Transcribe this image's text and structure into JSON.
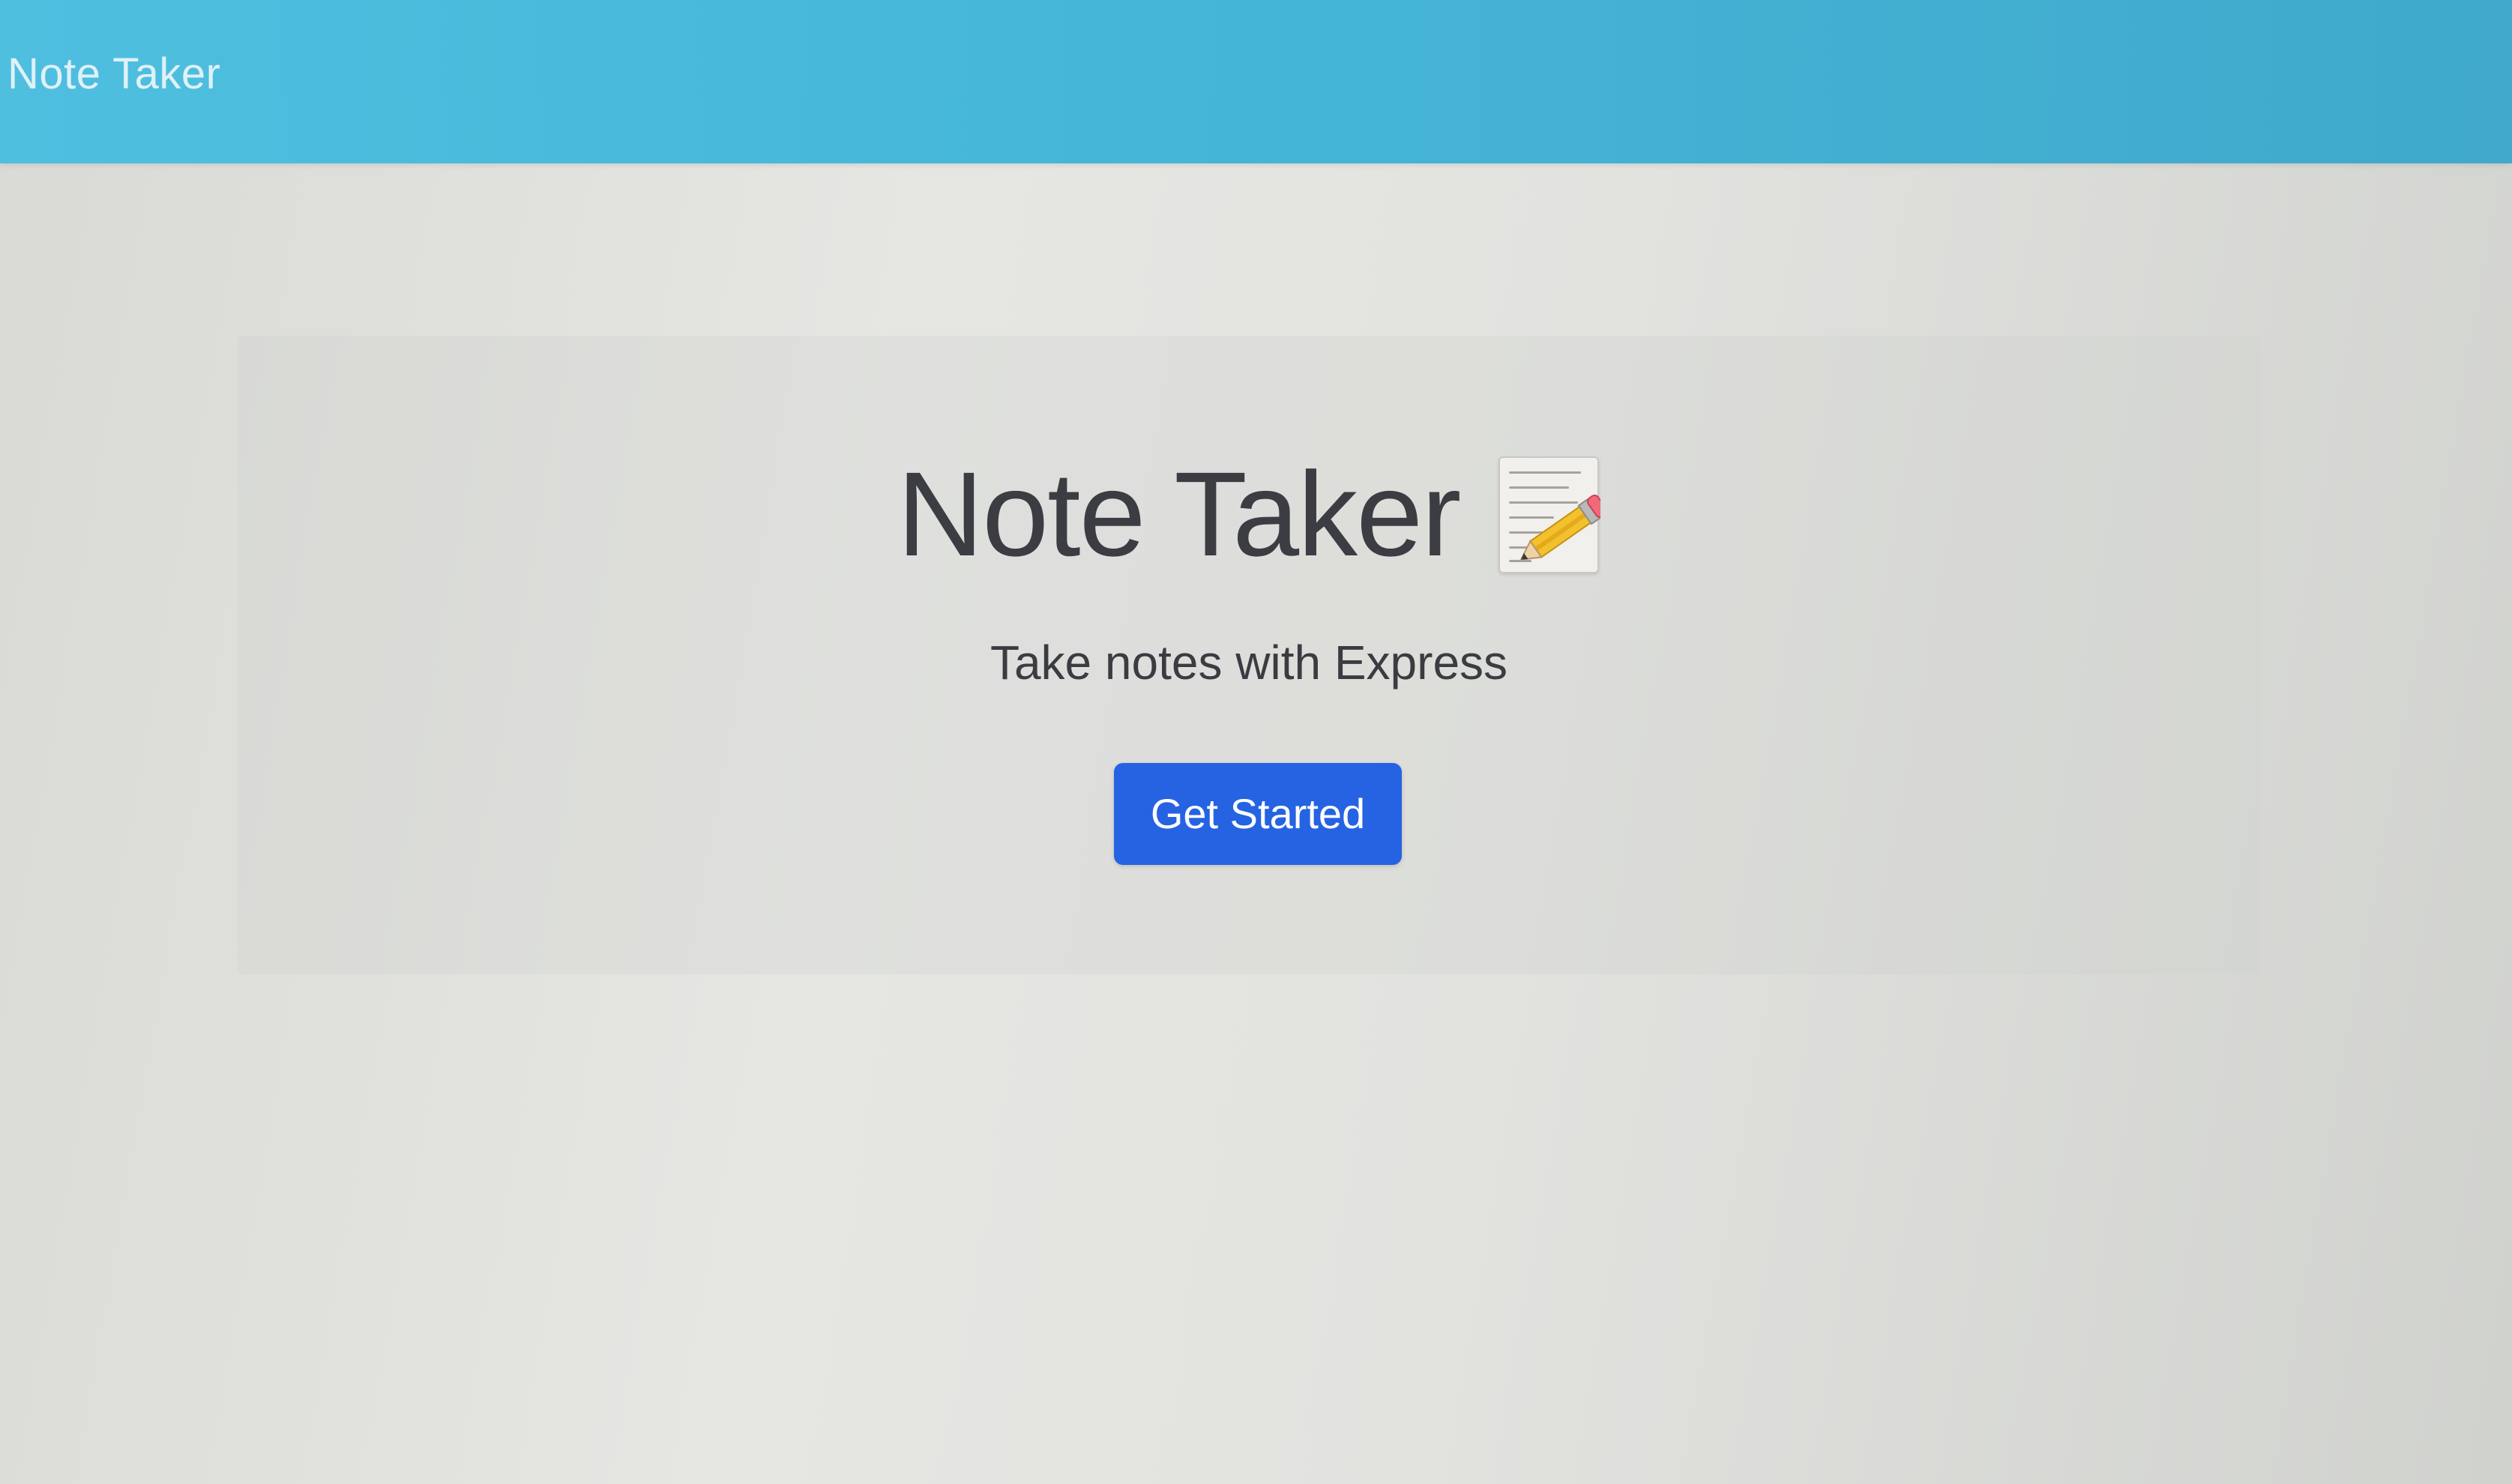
{
  "navbar": {
    "brand": "Note Taker"
  },
  "hero": {
    "title": "Note Taker",
    "title_icon": "memo-pencil-icon",
    "lead": "Take notes with Express",
    "cta_label": "Get Started"
  },
  "colors": {
    "navbar": "#45b6d8",
    "page_background": "#e2e2df",
    "button": "#2563e3",
    "title_text": "#3b3d42"
  }
}
